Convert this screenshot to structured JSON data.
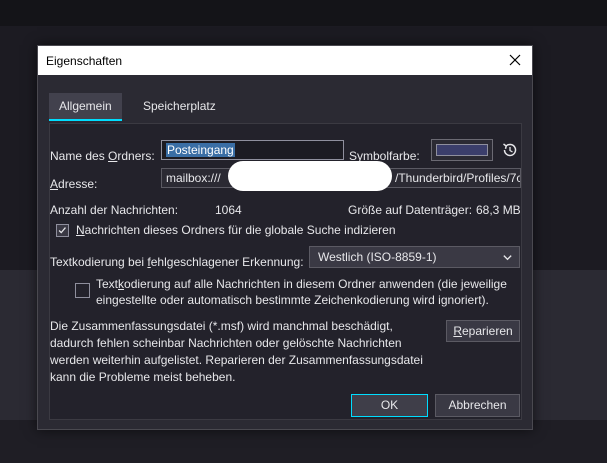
{
  "dialog": {
    "title": "Eigenschaften",
    "tabs": [
      {
        "label": "Allgemein",
        "active": true
      },
      {
        "label": "Speicherplatz",
        "active": false
      }
    ],
    "folder_name": {
      "label_pre": "Name des ",
      "label_u": "O",
      "label_post": "rdners:",
      "value": "Posteingang"
    },
    "symbol_color": {
      "label_u": "S",
      "label_post": "ymbolfarbe:",
      "swatch_color": "#3b3e6b"
    },
    "address": {
      "label_u": "A",
      "label_post": "dresse:",
      "value_start": "mailbox:///",
      "value_end": "/Thunderbird/Profiles/7c"
    },
    "messages_count": {
      "label": "Anzahl der Nachrichten:",
      "value": "1064"
    },
    "disk_size": {
      "label": "Größe auf Datenträger:",
      "value": "68,3 MB"
    },
    "global_search": {
      "checked": true,
      "label_u": "N",
      "label_post": "achrichten dieses Ordners für die globale Suche indizieren"
    },
    "encoding": {
      "label_pre": "Textkodierung bei ",
      "label_u": "f",
      "label_post": "ehlgeschlagener Erkennung:",
      "selected": "Westlich (ISO-8859-1)"
    },
    "apply_all": {
      "checked": false,
      "line1_pre": "Text",
      "line1_u": "k",
      "line1_post": "odierung auf alle Nachrichten in diesem Ordner anwenden (die jeweilige",
      "line2": "eingestellte oder automatisch bestimmte Zeichenkodierung wird ignoriert)."
    },
    "summary_text": [
      "Die Zusammenfassungsdatei (*.msf) wird manchmal beschädigt,",
      "dadurch fehlen scheinbar Nachrichten oder gelöschte Nachrichten",
      "werden weiterhin aufgelistet. Reparieren der Zusammenfassungsdatei",
      "kann die Probleme meist beheben."
    ],
    "repair_button": {
      "label_u": "R",
      "label_post": "eparieren"
    },
    "ok_button": "OK",
    "cancel_button": "Abbrechen"
  }
}
